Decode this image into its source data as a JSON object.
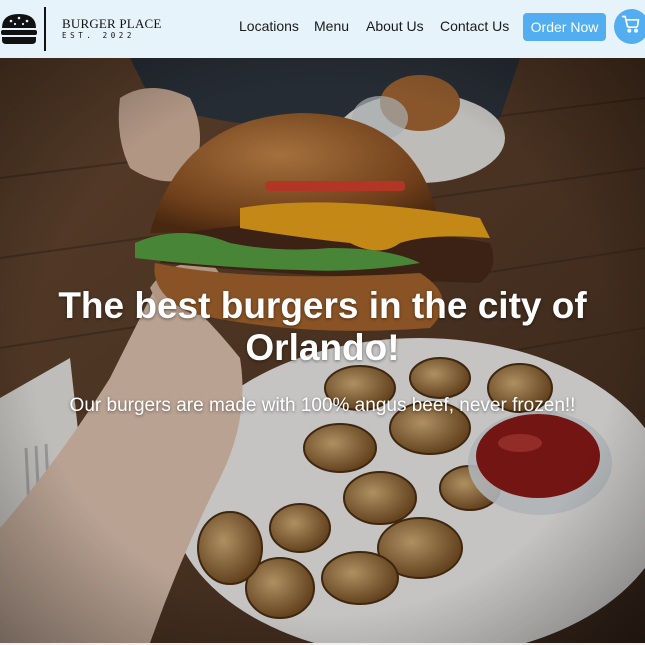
{
  "header": {
    "logo_icon": "burger-icon",
    "brand_name": "BURGER PLACE",
    "brand_est": "EST. 2022",
    "nav": [
      {
        "label": "Locations"
      },
      {
        "label": "Menu"
      },
      {
        "label": "About Us"
      },
      {
        "label": "Contact Us"
      }
    ],
    "order_button_label": "Order Now",
    "cart_icon": "shopping-cart-icon"
  },
  "hero": {
    "title": "The best burgers in the city of Orlando!",
    "subtitle": "Our burgers are made with 100% angus beef, never frozen!!",
    "image": "photo-of-hand-holding-burger-over-plate-of-potato-wedges-and-ketchup"
  },
  "colors": {
    "header_bg": "#e6f3fb",
    "accent": "#52aef0",
    "text_dark": "#1a1a1a",
    "hero_text": "#ffffff"
  }
}
